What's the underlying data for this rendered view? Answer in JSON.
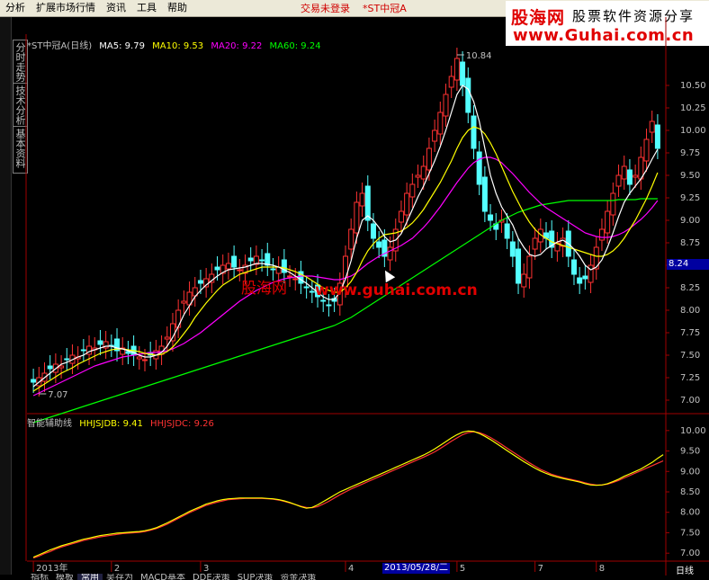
{
  "menu": {
    "items": [
      "分析",
      "扩展市场行情",
      "资讯",
      "工具",
      "帮助"
    ],
    "status": "交易未登录",
    "stock_tag": "*ST中冠A"
  },
  "logo": {
    "brand": "股海网",
    "slogan": "股票软件资源分享",
    "url": "www.Guhai.com.cn"
  },
  "side_tabs": [
    "分时走势",
    "技术分析",
    "基本资料"
  ],
  "main_legend": {
    "title": "*ST中冠A(日线)",
    "ma5": "MA5: 9.79",
    "ma10": "MA10: 9.53",
    "ma20": "MA20: 9.22",
    "ma60": "MA60: 9.24"
  },
  "sub_legend": {
    "title": "智能辅助线",
    "line1": "HHJSJDB: 9.41",
    "line2": "HHJSJDC: 9.26"
  },
  "annotations": {
    "high": "10.84",
    "low": "7.07",
    "current_price": "8.24",
    "watermark_cn": "股海网",
    "watermark_url": "www.guhai.com.cn"
  },
  "main_axis_ticks": [
    "10.50",
    "10.25",
    "10.00",
    "9.75",
    "9.50",
    "9.25",
    "9.00",
    "8.75",
    "8.50",
    "8.25",
    "8.00",
    "7.75",
    "7.50",
    "7.25",
    "7.00"
  ],
  "sub_axis_ticks": [
    "10.00",
    "9.50",
    "9.00",
    "8.50",
    "8.00",
    "7.50",
    "7.00"
  ],
  "x_axis": {
    "labels": [
      "2013年",
      "2",
      "3",
      "4",
      "5",
      "7",
      "8"
    ],
    "selected_date": "2013/05/28/二",
    "period": "日线"
  },
  "bottom_tabs": [
    "指标",
    "模板",
    "常用",
    "吴存为",
    "MACD基本",
    "DDE决策",
    "SUP决策",
    "资金决策"
  ],
  "colors": {
    "up": "#ff3232",
    "down": "#54ffff",
    "ma5": "#ffffff",
    "ma10": "#ffff00",
    "ma20": "#ff00ff",
    "ma60": "#00ff00",
    "axis": "#a00000"
  },
  "chart_data": {
    "type": "candlestick",
    "title": "*ST中冠A(日线)",
    "ylim": [
      6.9,
      10.9
    ],
    "closes": [
      7.2,
      7.25,
      7.3,
      7.35,
      7.4,
      7.38,
      7.45,
      7.5,
      7.48,
      7.55,
      7.6,
      7.58,
      7.62,
      7.65,
      7.6,
      7.55,
      7.58,
      7.52,
      7.5,
      7.48,
      7.45,
      7.5,
      7.55,
      7.6,
      7.7,
      7.85,
      8.0,
      8.1,
      8.2,
      8.25,
      8.3,
      8.35,
      8.4,
      8.45,
      8.5,
      8.52,
      8.48,
      8.45,
      8.5,
      8.55,
      8.6,
      8.55,
      8.5,
      8.45,
      8.48,
      8.42,
      8.38,
      8.35,
      8.3,
      8.25,
      8.2,
      8.15,
      8.1,
      8.05,
      8.1,
      8.3,
      8.6,
      8.9,
      9.2,
      9.3,
      9.0,
      8.8,
      8.7,
      8.6,
      8.7,
      8.9,
      9.1,
      9.3,
      9.4,
      9.5,
      9.6,
      9.8,
      10.0,
      10.2,
      10.4,
      10.6,
      10.8,
      10.5,
      10.2,
      9.8,
      9.4,
      9.1,
      9.0,
      8.9,
      9.0,
      8.8,
      8.6,
      8.3,
      8.4,
      8.6,
      8.8,
      8.9,
      8.8,
      8.7,
      8.75,
      8.8,
      8.6,
      8.4,
      8.3,
      8.35,
      8.5,
      8.7,
      8.9,
      9.1,
      9.3,
      9.5,
      9.6,
      9.4,
      9.5,
      9.7,
      9.9,
      10.1,
      9.8
    ],
    "ma5": [
      7.15,
      7.2,
      7.25,
      7.3,
      7.35,
      7.4,
      7.42,
      7.45,
      7.48,
      7.5,
      7.54,
      7.56,
      7.58,
      7.6,
      7.6,
      7.58,
      7.57,
      7.55,
      7.53,
      7.5,
      7.48,
      7.48,
      7.5,
      7.53,
      7.6,
      7.7,
      7.82,
      7.95,
      8.05,
      8.15,
      8.22,
      8.28,
      8.33,
      8.38,
      8.42,
      8.45,
      8.46,
      8.47,
      8.48,
      8.5,
      8.52,
      8.52,
      8.51,
      8.5,
      8.48,
      8.45,
      8.42,
      8.38,
      8.34,
      8.3,
      8.25,
      8.2,
      8.15,
      8.12,
      8.12,
      8.2,
      8.35,
      8.55,
      8.8,
      9.0,
      9.05,
      9.0,
      8.92,
      8.82,
      8.76,
      8.78,
      8.85,
      8.98,
      9.12,
      9.26,
      9.38,
      9.52,
      9.66,
      9.82,
      10.0,
      10.2,
      10.4,
      10.5,
      10.46,
      10.32,
      10.1,
      9.8,
      9.5,
      9.3,
      9.15,
      9.05,
      8.95,
      8.8,
      8.7,
      8.62,
      8.6,
      8.62,
      8.68,
      8.72,
      8.76,
      8.78,
      8.74,
      8.68,
      8.6,
      8.5,
      8.45,
      8.48,
      8.56,
      8.7,
      8.86,
      9.04,
      9.2,
      9.3,
      9.38,
      9.46,
      9.56,
      9.68,
      9.79
    ],
    "ma10": [
      7.1,
      7.14,
      7.18,
      7.22,
      7.26,
      7.3,
      7.33,
      7.36,
      7.4,
      7.43,
      7.46,
      7.49,
      7.52,
      7.54,
      7.56,
      7.57,
      7.57,
      7.56,
      7.55,
      7.54,
      7.52,
      7.51,
      7.5,
      7.51,
      7.54,
      7.59,
      7.66,
      7.74,
      7.82,
      7.92,
      8.0,
      8.08,
      8.15,
      8.22,
      8.28,
      8.32,
      8.36,
      8.4,
      8.42,
      8.44,
      8.46,
      8.48,
      8.48,
      8.48,
      8.48,
      8.47,
      8.45,
      8.43,
      8.4,
      8.37,
      8.33,
      8.29,
      8.25,
      8.22,
      8.2,
      8.2,
      8.25,
      8.32,
      8.42,
      8.55,
      8.66,
      8.74,
      8.8,
      8.84,
      8.85,
      8.86,
      8.88,
      8.92,
      8.97,
      9.04,
      9.12,
      9.22,
      9.32,
      9.42,
      9.54,
      9.66,
      9.8,
      9.92,
      10.0,
      10.04,
      10.02,
      9.96,
      9.86,
      9.74,
      9.6,
      9.46,
      9.32,
      9.2,
      9.08,
      8.98,
      8.9,
      8.84,
      8.8,
      8.76,
      8.74,
      8.72,
      8.7,
      8.68,
      8.66,
      8.64,
      8.62,
      8.6,
      8.6,
      8.62,
      8.66,
      8.72,
      8.8,
      8.9,
      9.0,
      9.12,
      9.24,
      9.38,
      9.53
    ],
    "ma20": [
      7.05,
      7.08,
      7.11,
      7.14,
      7.17,
      7.2,
      7.23,
      7.26,
      7.29,
      7.32,
      7.35,
      7.38,
      7.4,
      7.42,
      7.44,
      7.46,
      7.48,
      7.49,
      7.5,
      7.51,
      7.52,
      7.53,
      7.53,
      7.54,
      7.55,
      7.57,
      7.6,
      7.63,
      7.67,
      7.71,
      7.75,
      7.8,
      7.85,
      7.9,
      7.95,
      8.0,
      8.05,
      8.1,
      8.14,
      8.18,
      8.22,
      8.25,
      8.28,
      8.31,
      8.33,
      8.35,
      8.36,
      8.37,
      8.38,
      8.38,
      8.38,
      8.37,
      8.36,
      8.35,
      8.34,
      8.34,
      8.36,
      8.38,
      8.42,
      8.47,
      8.52,
      8.56,
      8.6,
      8.63,
      8.66,
      8.69,
      8.72,
      8.76,
      8.8,
      8.86,
      8.92,
      8.99,
      9.07,
      9.15,
      9.24,
      9.33,
      9.42,
      9.5,
      9.58,
      9.64,
      9.68,
      9.7,
      9.7,
      9.68,
      9.64,
      9.58,
      9.52,
      9.45,
      9.38,
      9.31,
      9.25,
      9.19,
      9.14,
      9.1,
      9.06,
      9.02,
      8.98,
      8.94,
      8.9,
      8.86,
      8.84,
      8.82,
      8.81,
      8.81,
      8.82,
      8.84,
      8.87,
      8.91,
      8.96,
      9.01,
      9.07,
      9.14,
      9.22
    ],
    "ma60": [
      6.75,
      6.77,
      6.79,
      6.81,
      6.83,
      6.85,
      6.87,
      6.89,
      6.91,
      6.93,
      6.95,
      6.97,
      6.99,
      7.01,
      7.03,
      7.05,
      7.07,
      7.09,
      7.11,
      7.13,
      7.15,
      7.17,
      7.19,
      7.21,
      7.23,
      7.25,
      7.27,
      7.29,
      7.31,
      7.33,
      7.35,
      7.37,
      7.39,
      7.41,
      7.43,
      7.45,
      7.47,
      7.49,
      7.51,
      7.53,
      7.55,
      7.57,
      7.59,
      7.61,
      7.63,
      7.65,
      7.67,
      7.69,
      7.71,
      7.73,
      7.75,
      7.77,
      7.79,
      7.81,
      7.83,
      7.86,
      7.89,
      7.92,
      7.96,
      8.0,
      8.04,
      8.08,
      8.12,
      8.16,
      8.2,
      8.24,
      8.28,
      8.32,
      8.36,
      8.4,
      8.44,
      8.48,
      8.52,
      8.56,
      8.6,
      8.64,
      8.68,
      8.72,
      8.76,
      8.8,
      8.84,
      8.88,
      8.92,
      8.96,
      9.0,
      9.03,
      9.06,
      9.09,
      9.11,
      9.13,
      9.15,
      9.17,
      9.18,
      9.19,
      9.2,
      9.21,
      9.22,
      9.22,
      9.22,
      9.22,
      9.22,
      9.22,
      9.22,
      9.22,
      9.22,
      9.23,
      9.23,
      9.23,
      9.23,
      9.24,
      9.24,
      9.24,
      9.24
    ],
    "sub_ylim": [
      6.85,
      10.15
    ],
    "sub_b": [
      6.9,
      6.96,
      7.02,
      7.08,
      7.13,
      7.18,
      7.22,
      7.26,
      7.3,
      7.34,
      7.37,
      7.4,
      7.43,
      7.45,
      7.47,
      7.49,
      7.5,
      7.51,
      7.52,
      7.53,
      7.55,
      7.58,
      7.62,
      7.68,
      7.74,
      7.81,
      7.88,
      7.95,
      8.02,
      8.08,
      8.14,
      8.2,
      8.24,
      8.28,
      8.31,
      8.33,
      8.34,
      8.35,
      8.35,
      8.35,
      8.35,
      8.35,
      8.34,
      8.33,
      8.31,
      8.28,
      8.24,
      8.19,
      8.14,
      8.1,
      8.12,
      8.18,
      8.26,
      8.34,
      8.42,
      8.5,
      8.56,
      8.62,
      8.68,
      8.74,
      8.8,
      8.86,
      8.92,
      8.98,
      9.04,
      9.1,
      9.16,
      9.22,
      9.28,
      9.34,
      9.4,
      9.47,
      9.55,
      9.64,
      9.73,
      9.82,
      9.9,
      9.96,
      9.99,
      9.98,
      9.93,
      9.86,
      9.78,
      9.69,
      9.6,
      9.51,
      9.42,
      9.33,
      9.24,
      9.16,
      9.08,
      9.01,
      8.95,
      8.9,
      8.86,
      8.83,
      8.8,
      8.77,
      8.74,
      8.7,
      8.67,
      8.66,
      8.67,
      8.7,
      8.75,
      8.81,
      8.88,
      8.94,
      9.0,
      9.06,
      9.14,
      9.22,
      9.32,
      9.41
    ],
    "sub_c": [
      6.88,
      6.93,
      6.99,
      7.04,
      7.1,
      7.15,
      7.19,
      7.23,
      7.27,
      7.31,
      7.34,
      7.37,
      7.4,
      7.42,
      7.44,
      7.46,
      7.48,
      7.49,
      7.5,
      7.51,
      7.53,
      7.56,
      7.6,
      7.65,
      7.71,
      7.78,
      7.85,
      7.92,
      7.99,
      8.05,
      8.11,
      8.17,
      8.21,
      8.25,
      8.28,
      8.31,
      8.32,
      8.33,
      8.34,
      8.34,
      8.34,
      8.34,
      8.33,
      8.32,
      8.3,
      8.27,
      8.23,
      8.19,
      8.15,
      8.12,
      8.11,
      8.14,
      8.2,
      8.27,
      8.35,
      8.43,
      8.5,
      8.57,
      8.63,
      8.69,
      8.75,
      8.81,
      8.87,
      8.93,
      8.99,
      9.05,
      9.11,
      9.17,
      9.23,
      9.29,
      9.35,
      9.41,
      9.48,
      9.56,
      9.65,
      9.74,
      9.82,
      9.9,
      9.95,
      9.97,
      9.95,
      9.9,
      9.83,
      9.75,
      9.66,
      9.57,
      9.48,
      9.39,
      9.3,
      9.21,
      9.13,
      9.05,
      8.99,
      8.93,
      8.89,
      8.85,
      8.82,
      8.79,
      8.76,
      8.72,
      8.69,
      8.67,
      8.67,
      8.69,
      8.73,
      8.78,
      8.84,
      8.9,
      8.96,
      9.02,
      9.08,
      9.14,
      9.2,
      9.26
    ]
  }
}
